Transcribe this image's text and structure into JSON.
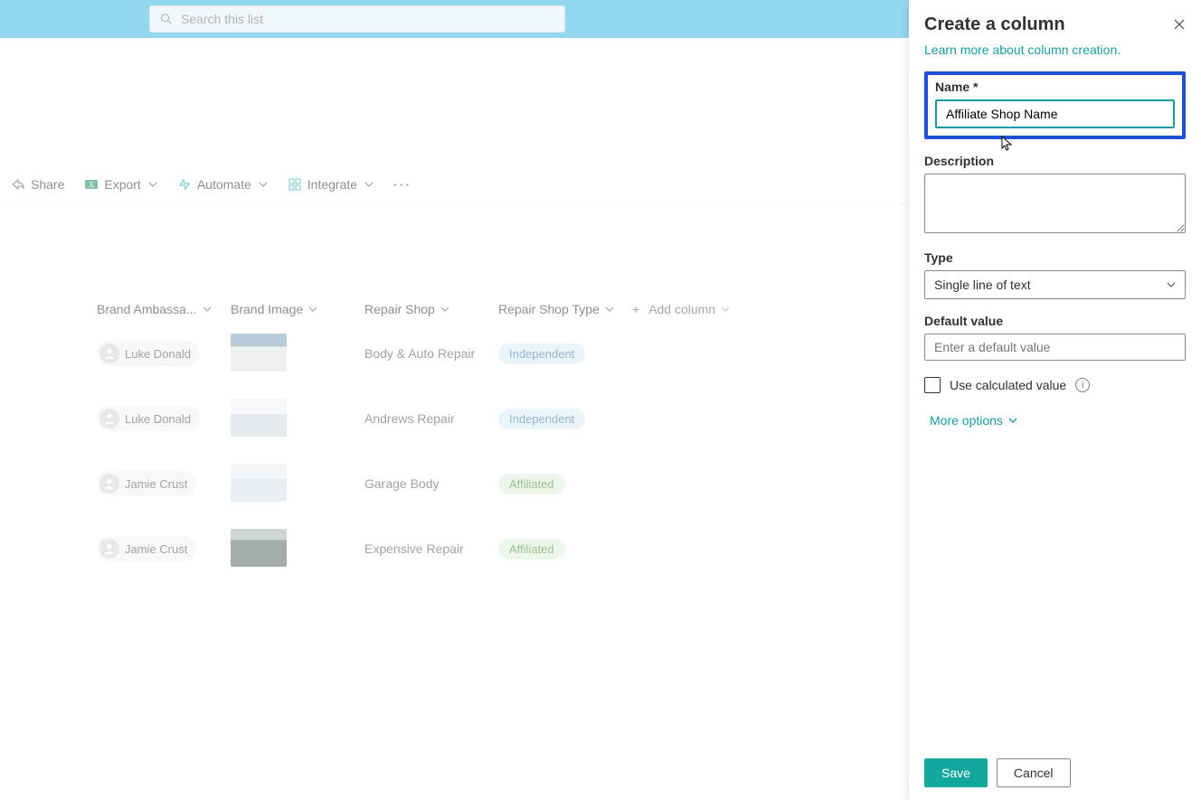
{
  "search": {
    "placeholder": "Search this list"
  },
  "commandbar": {
    "share": "Share",
    "export": "Export",
    "automate": "Automate",
    "integrate": "Integrate"
  },
  "columns": {
    "brand_ambass": "Brand Ambassa...",
    "brand_image": "Brand Image",
    "repair_shop": "Repair Shop",
    "repair_shop_type": "Repair Shop Type",
    "add_column": "Add column"
  },
  "rows": [
    {
      "ambassador": "Luke Donald",
      "shop": "Body & Auto Repair",
      "type": "Independent",
      "typeClass": "ind",
      "thumb": "car1"
    },
    {
      "ambassador": "Luke Donald",
      "shop": "Andrews Repair",
      "type": "Independent",
      "typeClass": "ind",
      "thumb": "car2"
    },
    {
      "ambassador": "Jamie Crust",
      "shop": "Garage Body",
      "type": "Affiliated",
      "typeClass": "aff",
      "thumb": "car3"
    },
    {
      "ambassador": "Jamie Crust",
      "shop": "Expensive Repair",
      "type": "Affiliated",
      "typeClass": "aff",
      "thumb": "car4"
    }
  ],
  "panel": {
    "title": "Create a column",
    "learn_more": "Learn more about column creation.",
    "name_label": "Name *",
    "name_value": "Affiliate Shop Name",
    "description_label": "Description",
    "type_label": "Type",
    "type_value": "Single line of text",
    "default_label": "Default value",
    "default_placeholder": "Enter a default value",
    "calc_label": "Use calculated value",
    "more_options": "More options",
    "save": "Save",
    "cancel": "Cancel"
  }
}
